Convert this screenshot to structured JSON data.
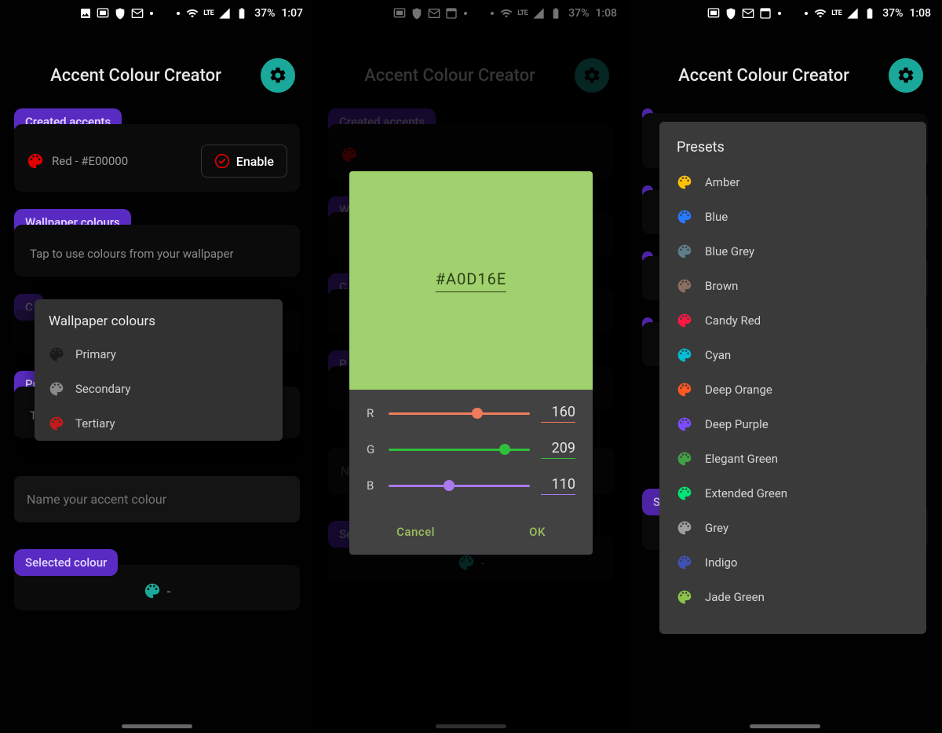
{
  "status": {
    "battery": "37%",
    "time1": "1:07",
    "time2": "1:08",
    "lte": "LTE"
  },
  "header": {
    "title": "Accent Colour Creator"
  },
  "chips": {
    "created": "Created accents",
    "wallpaper": "Wallpaper colours",
    "preset": "Preset colours",
    "selected": "Selected colour"
  },
  "accent": {
    "name": "Red - #E00000",
    "enable": "Enable",
    "color": "#E00000"
  },
  "hints": {
    "wallpaper": "Tap to use colours from your wallpaper",
    "preset": "Tap to use preset colours"
  },
  "wallpaper_popup": {
    "title": "Wallpaper colours",
    "items": [
      {
        "label": "Primary",
        "color": "#1a1a1a"
      },
      {
        "label": "Secondary",
        "color": "#8a8a8a"
      },
      {
        "label": "Tertiary",
        "color": "#c41a1a"
      }
    ]
  },
  "name_placeholder": "Name your accent colour",
  "selected_dash": "-",
  "picker": {
    "hex": "#A0D16E",
    "swatch": "#A0D16E",
    "r": {
      "label": "R",
      "value": "160",
      "color": "#f07b5c"
    },
    "g": {
      "label": "G",
      "value": "209",
      "color": "#2fbf3a"
    },
    "b": {
      "label": "B",
      "value": "110",
      "color": "#a97af0"
    },
    "cancel": "Cancel",
    "ok": "OK"
  },
  "presets": {
    "title": "Presets",
    "items": [
      {
        "label": "Amber",
        "color": "#ffc107"
      },
      {
        "label": "Blue",
        "color": "#2979ff"
      },
      {
        "label": "Blue Grey",
        "color": "#607d8b"
      },
      {
        "label": "Brown",
        "color": "#8d6e63"
      },
      {
        "label": "Candy Red",
        "color": "#ff1744"
      },
      {
        "label": "Cyan",
        "color": "#00bcd4"
      },
      {
        "label": "Deep Orange",
        "color": "#ff5722"
      },
      {
        "label": "Deep Purple",
        "color": "#7c4dff"
      },
      {
        "label": "Elegant Green",
        "color": "#43a047"
      },
      {
        "label": "Extended Green",
        "color": "#00e676"
      },
      {
        "label": "Grey",
        "color": "#9e9e9e"
      },
      {
        "label": "Indigo",
        "color": "#3f51b5"
      },
      {
        "label": "Jade Green",
        "color": "#8bc34a"
      }
    ]
  }
}
